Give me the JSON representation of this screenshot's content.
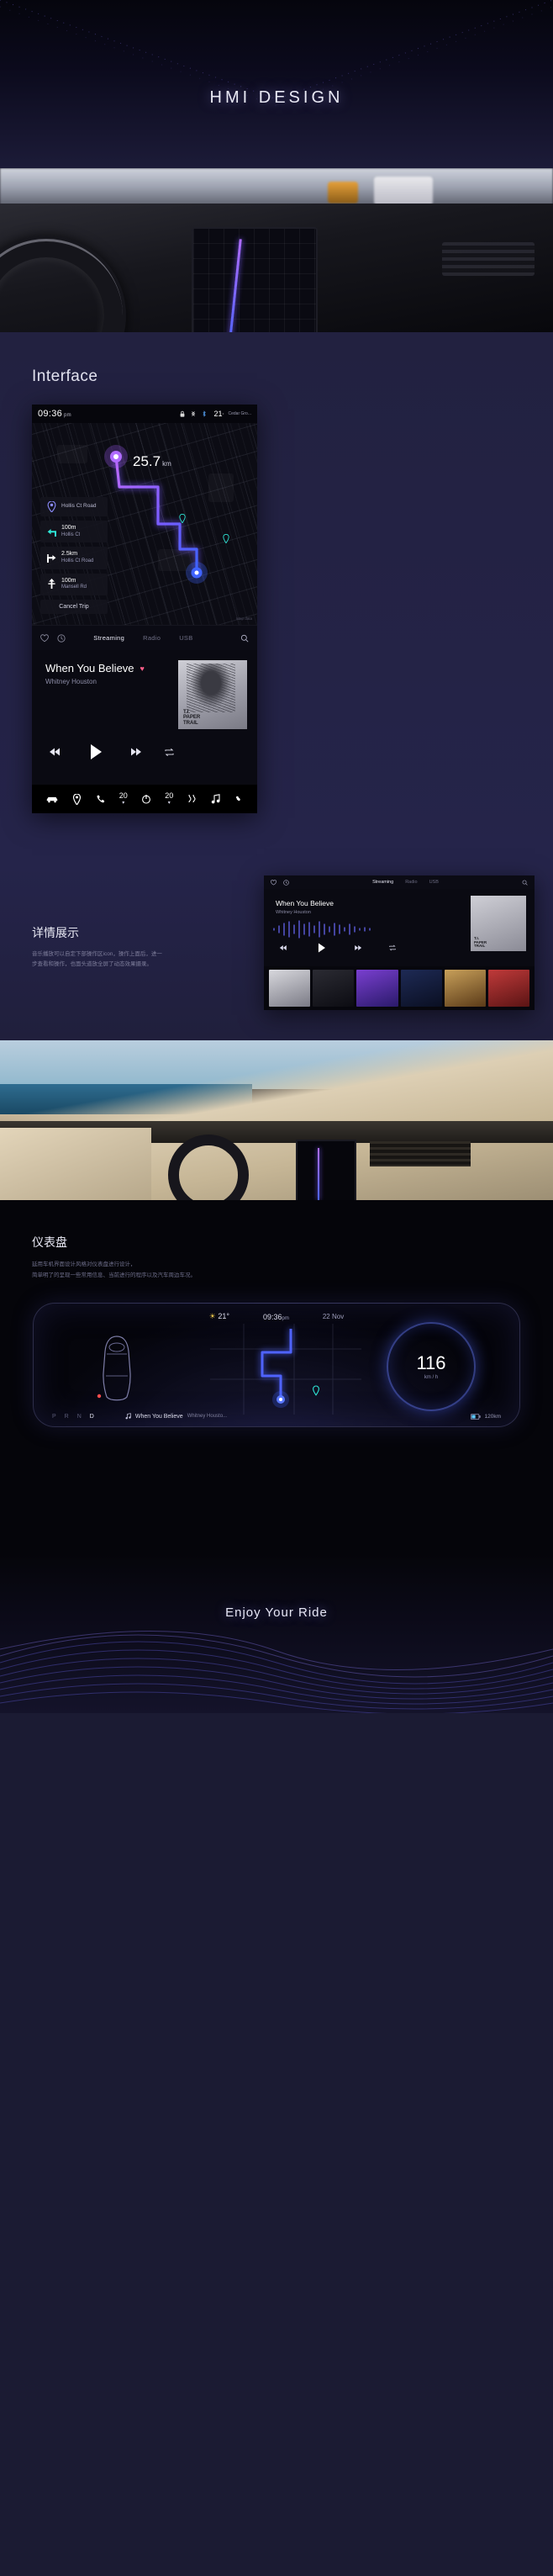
{
  "hero": {
    "title": "HMI DESIGN"
  },
  "sections": {
    "interface_heading": "Interface",
    "detail_heading": "详情展示",
    "detail_paragraph": "音乐播放可以自定下部操作区icon，操作上面后，进一步查看和操作，也面头道放全屏了动态效果摄录。",
    "dash_heading": "仪表盘",
    "dash_paragraph_1": "延用车机界面设计风格对仪表盘进行设计，",
    "dash_paragraph_2": "简单明了的呈现一些常用信息、当前进行的程序以及汽车周边车况。"
  },
  "screen": {
    "status": {
      "clock": "09:36",
      "meridiem": "pm",
      "icons": [
        "lock-icon",
        "bluetooth-share-icon",
        "bluetooth-icon"
      ],
      "temperature": "21",
      "temperature_unit": "°",
      "location": "Cedar Gro..."
    },
    "map": {
      "distance_value": "25.7",
      "distance_unit": "km",
      "attribution": "Map data",
      "destination": {
        "icon": "destination-pin-icon",
        "road": "Hollis Ct Road"
      },
      "steps": [
        {
          "icon": "turn-left-icon",
          "distance": "100m",
          "road": "Hollis Ct"
        },
        {
          "icon": "turn-right-icon",
          "distance": "2.5km",
          "road": "Hollis Ct Road"
        },
        {
          "icon": "straight-icon",
          "distance": "100m",
          "road": "Mansell Rd"
        }
      ],
      "cancel_label": "Cancel Trip"
    },
    "media": {
      "left_icons": [
        "heart-icon",
        "history-clock-icon"
      ],
      "right_icon": "search-icon",
      "tabs": [
        {
          "label": "Streaming",
          "active": true
        },
        {
          "label": "Radio",
          "active": false
        },
        {
          "label": "USB",
          "active": false
        }
      ],
      "track_title": "When You Believe",
      "track_artist": "Whitney Houston",
      "favorite_icon": "heart-filled-icon",
      "controls": [
        "previous-icon",
        "play-icon",
        "next-icon",
        "repeat-icon"
      ],
      "album_caption": "T.I.\nPAPER\nTRAIL"
    },
    "dock": [
      {
        "icon": "car-icon",
        "label": ""
      },
      {
        "icon": "navigation-icon",
        "label": ""
      },
      {
        "icon": "phone-icon",
        "label": ""
      },
      {
        "icon": "temp-left-icon",
        "label": "20"
      },
      {
        "icon": "power-icon",
        "label": ""
      },
      {
        "icon": "temp-right-icon",
        "label": "20"
      },
      {
        "icon": "seat-heat-icon",
        "label": ""
      },
      {
        "icon": "music-note-icon",
        "label": ""
      },
      {
        "icon": "fan-icon",
        "label": ""
      }
    ]
  },
  "mini_player": {
    "left_icons": [
      "heart-icon",
      "history-clock-icon"
    ],
    "right_icon": "search-icon",
    "tabs": [
      {
        "label": "Streaming",
        "active": true
      },
      {
        "label": "Radio",
        "active": false
      },
      {
        "label": "USB",
        "active": false
      }
    ],
    "track_title": "When You Believe",
    "track_artist": "Whitney Houston",
    "album_caption": "T.I.\nPAPER\nTRAIL",
    "playlist_count": 6
  },
  "cluster": {
    "temperature": "21",
    "temperature_unit": "°",
    "clock": "09:36",
    "meridiem": "pm",
    "date": "22 Nov",
    "speed_value": "116",
    "speed_unit": "km / h",
    "gears": [
      {
        "label": "P",
        "active": false
      },
      {
        "label": "R",
        "active": false
      },
      {
        "label": "N",
        "active": false
      },
      {
        "label": "D",
        "active": true
      }
    ],
    "song_title": "When You Believe",
    "song_artist": "Whitney Housto...",
    "range": "120km",
    "range_icon": "battery-icon",
    "song_icon": "music-note-icon"
  },
  "footer": {
    "tagline": "Enjoy Your Ride"
  },
  "colors": {
    "page_bg": "#23223f",
    "screen_bg": "#07070d",
    "accent_purple": "#7a5cff",
    "accent_blue": "#4a63ff",
    "accent_cyan": "#2ee6d6",
    "heart_pink": "#ff5f8a"
  }
}
